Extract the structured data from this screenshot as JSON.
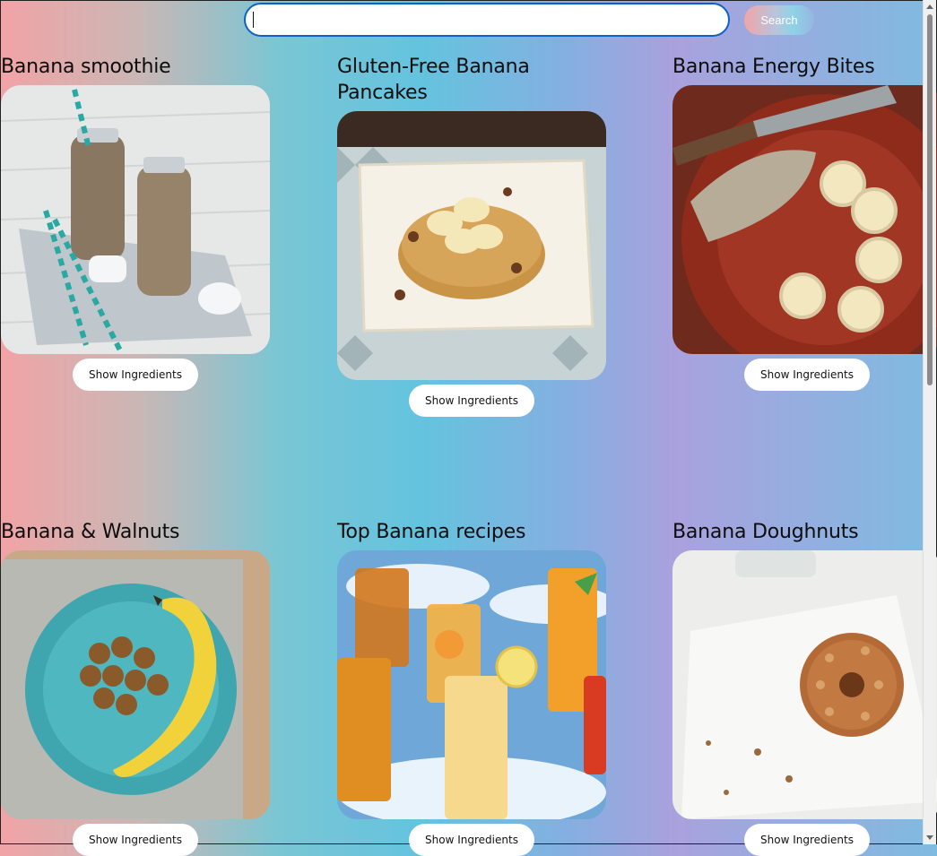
{
  "search": {
    "placeholder": "",
    "value": "",
    "button_label": "Search"
  },
  "recipes": [
    {
      "title": "Banana smoothie",
      "button_label": "Show Ingredients"
    },
    {
      "title": "Gluten-Free Banana Pancakes",
      "button_label": "Show Ingredients"
    },
    {
      "title": "Banana Energy Bites",
      "button_label": "Show Ingredients"
    },
    {
      "title": "Banana & Walnuts",
      "button_label": "Show Ingredients"
    },
    {
      "title": "Top Banana recipes",
      "button_label": "Show Ingredients"
    },
    {
      "title": "Banana Doughnuts",
      "button_label": "Show Ingredients"
    }
  ],
  "colors": {
    "search_border": "#0a63c9",
    "button_bg": "#ffffff"
  }
}
